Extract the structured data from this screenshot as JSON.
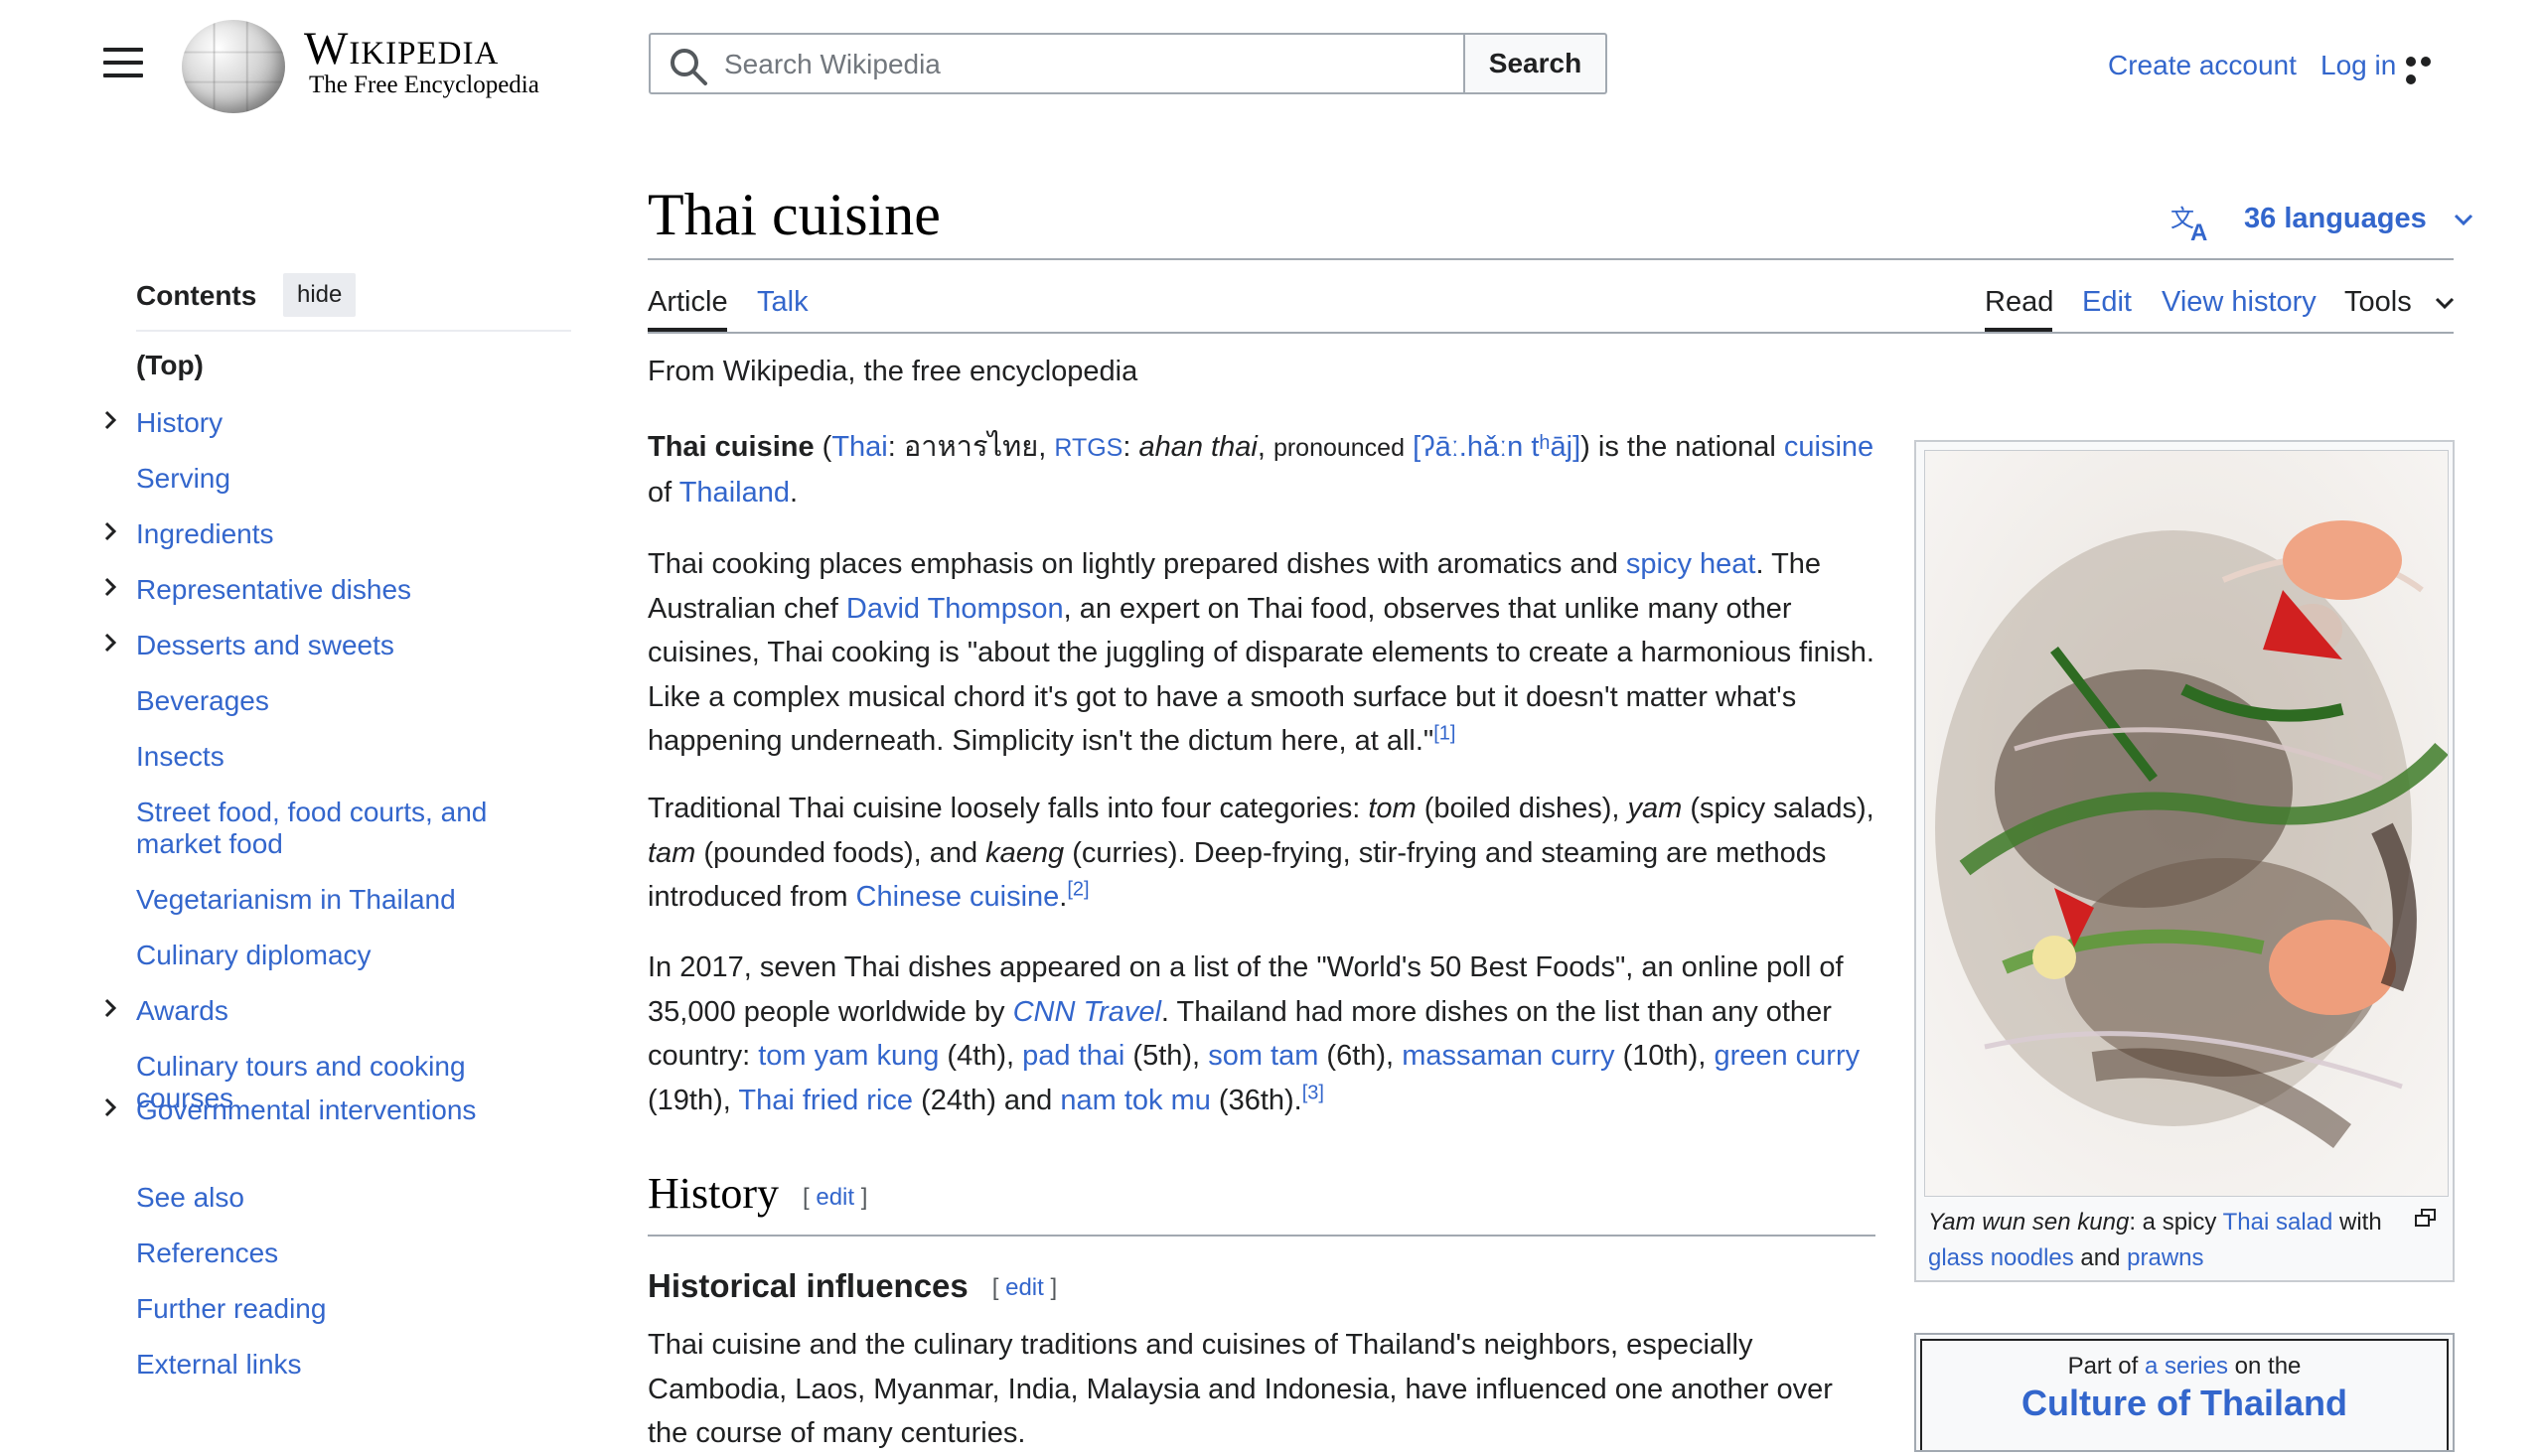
{
  "header": {
    "logo_title": "Wikipedia",
    "logo_tagline": "The Free Encyclopedia",
    "search_placeholder": "Search Wikipedia",
    "search_button": "Search",
    "create_account": "Create account",
    "log_in": "Log in"
  },
  "toc": {
    "title": "Contents",
    "hide_label": "hide",
    "items": [
      {
        "label": "(Top)"
      },
      {
        "label": "History",
        "expandable": true
      },
      {
        "label": "Serving"
      },
      {
        "label": "Ingredients",
        "expandable": true
      },
      {
        "label": "Representative dishes",
        "expandable": true
      },
      {
        "label": "Desserts and sweets",
        "expandable": true
      },
      {
        "label": "Beverages"
      },
      {
        "label": "Insects"
      },
      {
        "label": "Street food, food courts, and market food"
      },
      {
        "label": "Vegetarianism in Thailand"
      },
      {
        "label": "Culinary diplomacy"
      },
      {
        "label": "Awards",
        "expandable": true
      },
      {
        "label": "Culinary tours and cooking courses"
      },
      {
        "label": "Governmental interventions",
        "expandable": true
      },
      {
        "label": "See also"
      },
      {
        "label": "References"
      },
      {
        "label": "Further reading"
      },
      {
        "label": "External links"
      }
    ]
  },
  "article": {
    "title": "Thai cuisine",
    "languages": "36 languages",
    "tabs": {
      "article": "Article",
      "talk": "Talk",
      "read": "Read",
      "edit": "Edit",
      "view_history": "View history",
      "tools": "Tools"
    },
    "tagline": "From Wikipedia, the free encyclopedia",
    "history_heading": "History",
    "historical_influences_heading": "Historical influences",
    "edit_label": "edit",
    "last_paragraph": "Thai cuisine and the culinary traditions and cuisines of Thailand's neighbors, especially Cambodia, Laos, Myanmar, India, Malaysia and Indonesia, have influenced one another over the course of many centuries."
  },
  "infobox": {
    "caption_italic": "Yam wun sen kung",
    "caption_text1": ": a spicy ",
    "caption_link1": "Thai salad",
    "caption_text2": " with ",
    "caption_link2": "glass noodles",
    "caption_text3": " and ",
    "caption_link3": "prawns",
    "series_pre": "Part of",
    "series_link": "a series",
    "series_post": "on the",
    "series_title": "Culture of Thailand"
  }
}
